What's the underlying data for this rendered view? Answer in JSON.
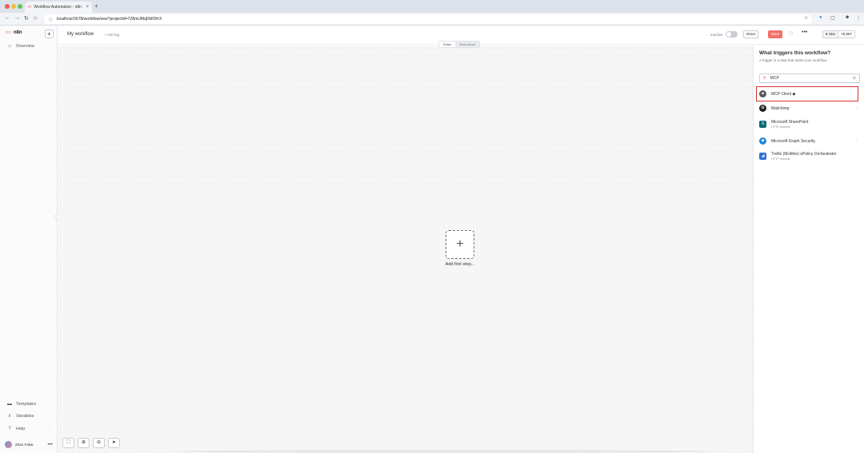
{
  "browser": {
    "tab_title": "Workflow Automation - n8n",
    "url": "localhost:5678/workflow/new?projectId=7Z8mUMqDkfOfrrX"
  },
  "sidebar": {
    "logo": "n8n",
    "overview": "Overview",
    "templates": "Templates",
    "variables": "Variables",
    "help": "Help",
    "user_name": "Zhao Fakai"
  },
  "header": {
    "workflow_name": "My workflow",
    "add_tag": "+ Add tag",
    "status": "Inactive",
    "share": "Share",
    "save": "Save",
    "star": "Star",
    "star_count": "75,687",
    "tabs": {
      "editor": "Editor",
      "executions": "Executions"
    }
  },
  "canvas": {
    "add_first_step": "Add first step..."
  },
  "trigger_panel": {
    "title": "What triggers this workflow?",
    "subtitle": "A trigger is a step that starts your workflow",
    "search_value": "MCP",
    "results": [
      {
        "name": "MCP Client",
        "sub": ""
      },
      {
        "name": "Mailchimp",
        "sub": ""
      },
      {
        "name": "Microsoft SharePoint",
        "sub": "HTTP request"
      },
      {
        "name": "Microsoft Graph Security",
        "sub": ""
      },
      {
        "name": "Trellix (McAfee) ePolicy Orchestrator",
        "sub": "HTTP request"
      }
    ]
  },
  "colors": {
    "brand": "#ea4b71",
    "save_button": "#f2716b",
    "highlight": "#d0312d"
  }
}
